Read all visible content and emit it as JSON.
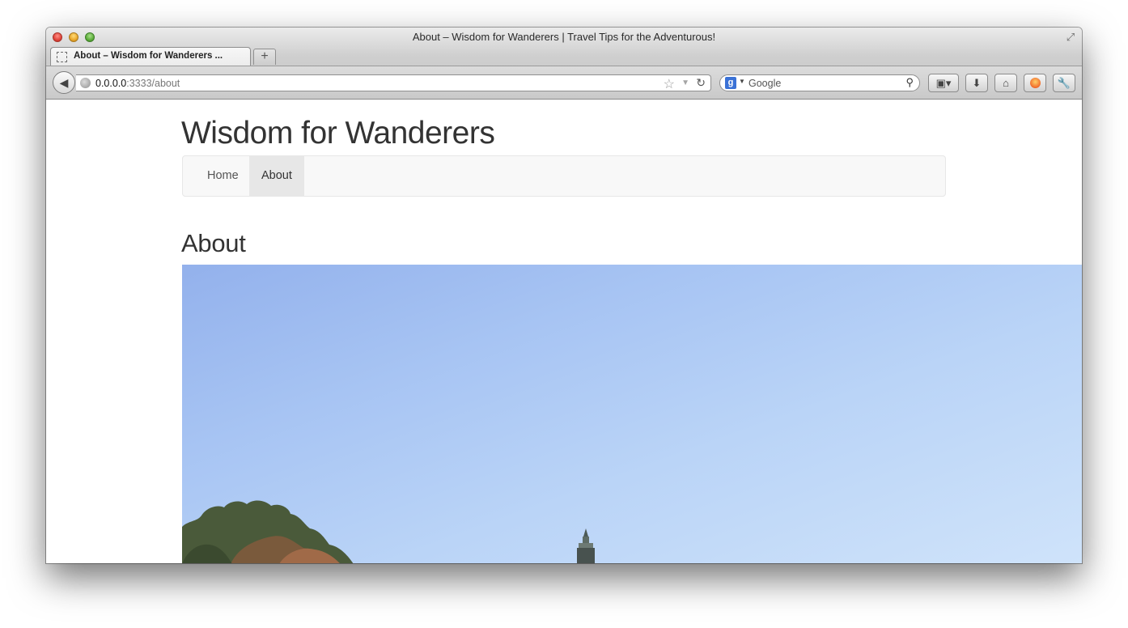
{
  "browser": {
    "window_title": "About – Wisdom for Wanderers | Travel Tips for the Adventurous!",
    "tab_label": "About – Wisdom for Wanderers ...",
    "new_tab_symbol": "+",
    "url_host": "0.0.0.0",
    "url_rest": ":3333/about",
    "search_engine": "Google",
    "search_placeholder": "Google",
    "icons": [
      "back-icon",
      "globe-icon",
      "star-icon",
      "reload-icon",
      "google-icon",
      "search-icon",
      "bookmarks-icon",
      "download-icon",
      "home-icon",
      "persona-icon",
      "wrench-icon",
      "fullscreen-icon"
    ]
  },
  "site": {
    "title": "Wisdom for Wanderers",
    "nav": [
      "Home",
      "About"
    ],
    "active_nav": "About"
  },
  "page": {
    "heading": "About"
  },
  "colors": {
    "text": "#333333",
    "nav_bg": "#f8f8f8",
    "nav_active_bg": "#e7e7e7",
    "sky_top": "#93b1ec",
    "sky_bottom": "#cfe3fa"
  }
}
